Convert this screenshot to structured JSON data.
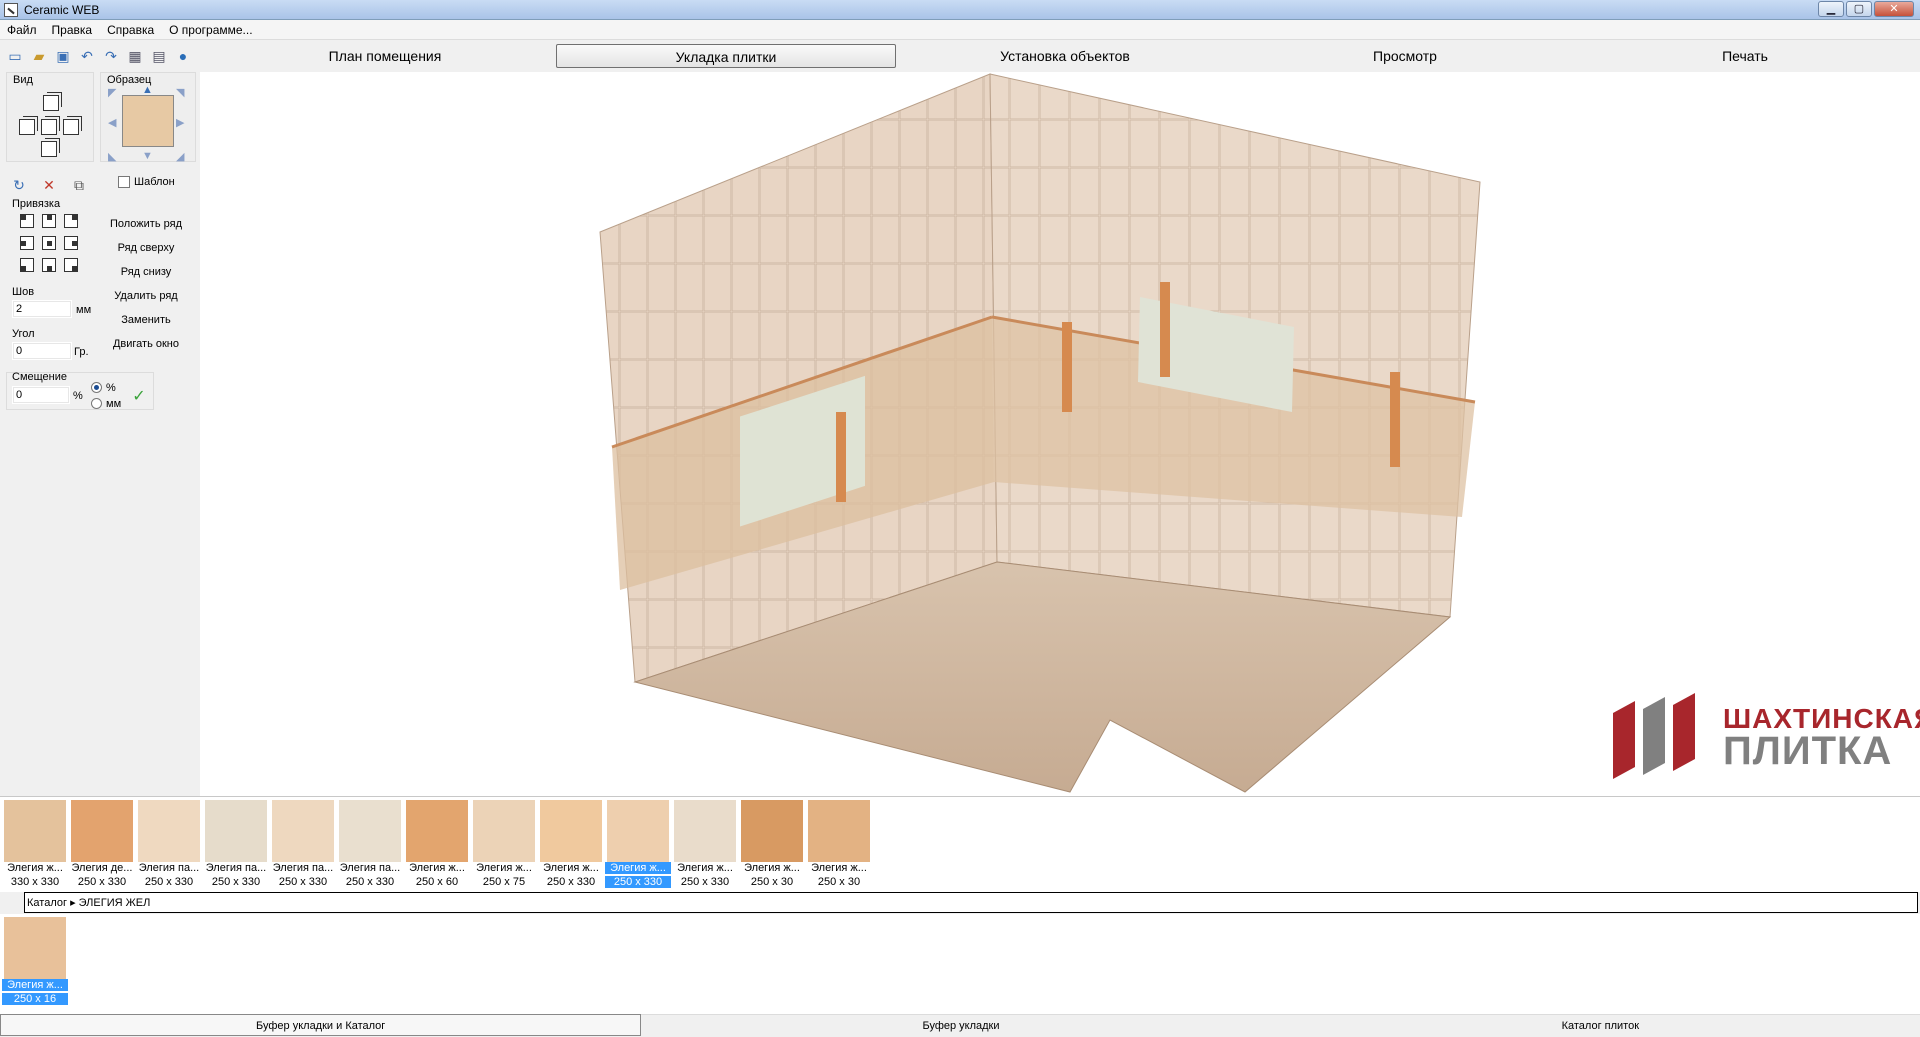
{
  "window": {
    "title": "Ceramic WEB"
  },
  "menu": [
    "Файл",
    "Правка",
    "Справка",
    "О программе..."
  ],
  "toolbar_icons": [
    "new-file-icon",
    "open-folder-icon",
    "save-icon",
    "undo-icon",
    "redo-icon",
    "calculator-icon",
    "grid-icon",
    "globe-icon"
  ],
  "modes": [
    {
      "label": "План помещения",
      "active": false
    },
    {
      "label": "Укладка плитки",
      "active": true
    },
    {
      "label": "Установка объектов",
      "active": false
    },
    {
      "label": "Просмотр",
      "active": false
    },
    {
      "label": "Печать",
      "active": false
    }
  ],
  "panel": {
    "view_label": "Вид",
    "sample_label": "Образец",
    "template_label": "Шаблон",
    "snap_label": "Привязка",
    "actions": [
      "Положить ряд",
      "Ряд сверху",
      "Ряд снизу",
      "Удалить ряд",
      "Заменить",
      "Двигать окно"
    ],
    "seam": {
      "label": "Шов",
      "value": "2",
      "unit": "мм"
    },
    "angle": {
      "label": "Угол",
      "value": "0",
      "unit": "Гр."
    },
    "offset": {
      "label": "Смещение",
      "value": "0",
      "unit": "%",
      "options": [
        "%",
        "мм"
      ],
      "selected": "%"
    }
  },
  "logo": {
    "line1": "ШАХТИНСКАЯ",
    "line2": "ПЛИТКА"
  },
  "catalog_tiles": [
    {
      "name": "Элегия ж...",
      "size": "330 x 330",
      "color": "#e4c29c",
      "selected": false
    },
    {
      "name": "Элегия де...",
      "size": "250 x 330",
      "color": "#e3a36e",
      "selected": false
    },
    {
      "name": "Элегия па...",
      "size": "250 x 330",
      "color": "#efd9c0",
      "selected": false
    },
    {
      "name": "Элегия па...",
      "size": "250 x 330",
      "color": "#e6dccb",
      "selected": false
    },
    {
      "name": "Элегия па...",
      "size": "250 x 330",
      "color": "#eed8bf",
      "selected": false
    },
    {
      "name": "Элегия па...",
      "size": "250 x 330",
      "color": "#e9dfcf",
      "selected": false
    },
    {
      "name": "Элегия ж...",
      "size": "250 x 60",
      "color": "#e3a56e",
      "selected": false
    },
    {
      "name": "Элегия ж...",
      "size": "250 x 75",
      "color": "#ecd3b7",
      "selected": false
    },
    {
      "name": "Элегия ж...",
      "size": "250 x 330",
      "color": "#f0c99e",
      "selected": false
    },
    {
      "name": "Элегия ж...",
      "size": "250 x 330",
      "color": "#eecfae",
      "selected": true
    },
    {
      "name": "Элегия ж...",
      "size": "250 x 330",
      "color": "#e9dccb",
      "selected": false
    },
    {
      "name": "Элегия ж...",
      "size": "250 x 30",
      "color": "#d89a62",
      "selected": false
    },
    {
      "name": "Элегия ж...",
      "size": "250 x 30",
      "color": "#e3b283",
      "selected": false
    }
  ],
  "breadcrumb": {
    "root": "Каталог",
    "current": "ЭЛЕГИЯ ЖЕЛ"
  },
  "buffer_tiles": [
    {
      "name": "Элегия ж...",
      "size": "250 x 16",
      "color": "#e8c19a",
      "selected": true
    }
  ],
  "bottom_tabs": [
    {
      "label": "Буфер укладки и Каталог",
      "active": true
    },
    {
      "label": "Буфер укладки",
      "active": false
    },
    {
      "label": "Каталог плиток",
      "active": false
    }
  ],
  "colors": {
    "accent": "#3399ff",
    "tile": "#e7c9a4",
    "logo_red": "#a8262c",
    "logo_gray": "#808080"
  }
}
